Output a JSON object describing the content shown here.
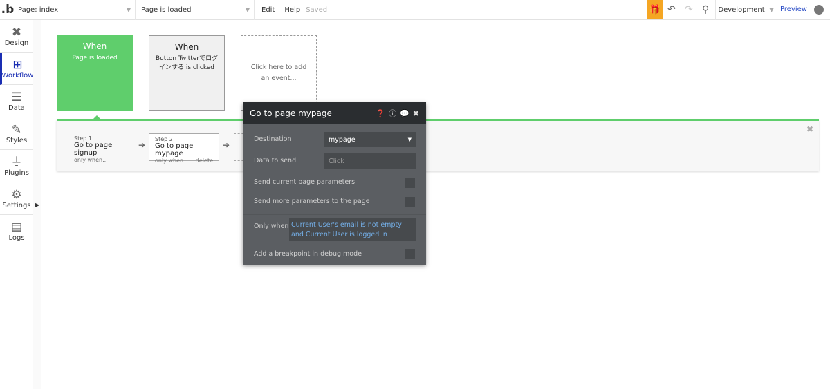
{
  "topbar": {
    "logo": ".b",
    "page_select": "Page: index",
    "event_select": "Page is loaded",
    "edit": "Edit",
    "help": "Help",
    "saved": "Saved",
    "environment": "Development",
    "preview": "Preview",
    "accent": "#f5a623"
  },
  "sidebar": {
    "items": [
      {
        "label": "Design",
        "icon": "design-icon"
      },
      {
        "label": "Workflow",
        "icon": "workflow-icon",
        "active": true
      },
      {
        "label": "Data",
        "icon": "database-icon"
      },
      {
        "label": "Styles",
        "icon": "brush-icon"
      },
      {
        "label": "Plugins",
        "icon": "plug-icon"
      },
      {
        "label": "Settings",
        "icon": "gear-icon"
      },
      {
        "label": "Logs",
        "icon": "document-icon"
      }
    ]
  },
  "events": [
    {
      "title": "When",
      "subtitle": "Page is loaded",
      "color": "#5fce6c"
    },
    {
      "title": "When",
      "subtitle": "Button Twitterでログインする is clicked"
    },
    {
      "placeholder": "Click here to add an event..."
    }
  ],
  "steps": [
    {
      "number": "Step 1",
      "action": "Go to page signup",
      "condition": "only when..."
    },
    {
      "number": "Step 2",
      "action": "Go to page mypage",
      "condition": "only when...",
      "delete": "delete"
    }
  ],
  "panel": {
    "title": "Go to page mypage",
    "destination_label": "Destination",
    "destination_value": "mypage",
    "data_label": "Data to send",
    "data_placeholder": "Click",
    "send_current_label": "Send current page parameters",
    "send_more_label": "Send more parameters to the page",
    "only_when_label": "Only when",
    "only_when_value": "Current User's email is not empty and Current User is logged in",
    "breakpoint_label": "Add a breakpoint in debug mode"
  }
}
